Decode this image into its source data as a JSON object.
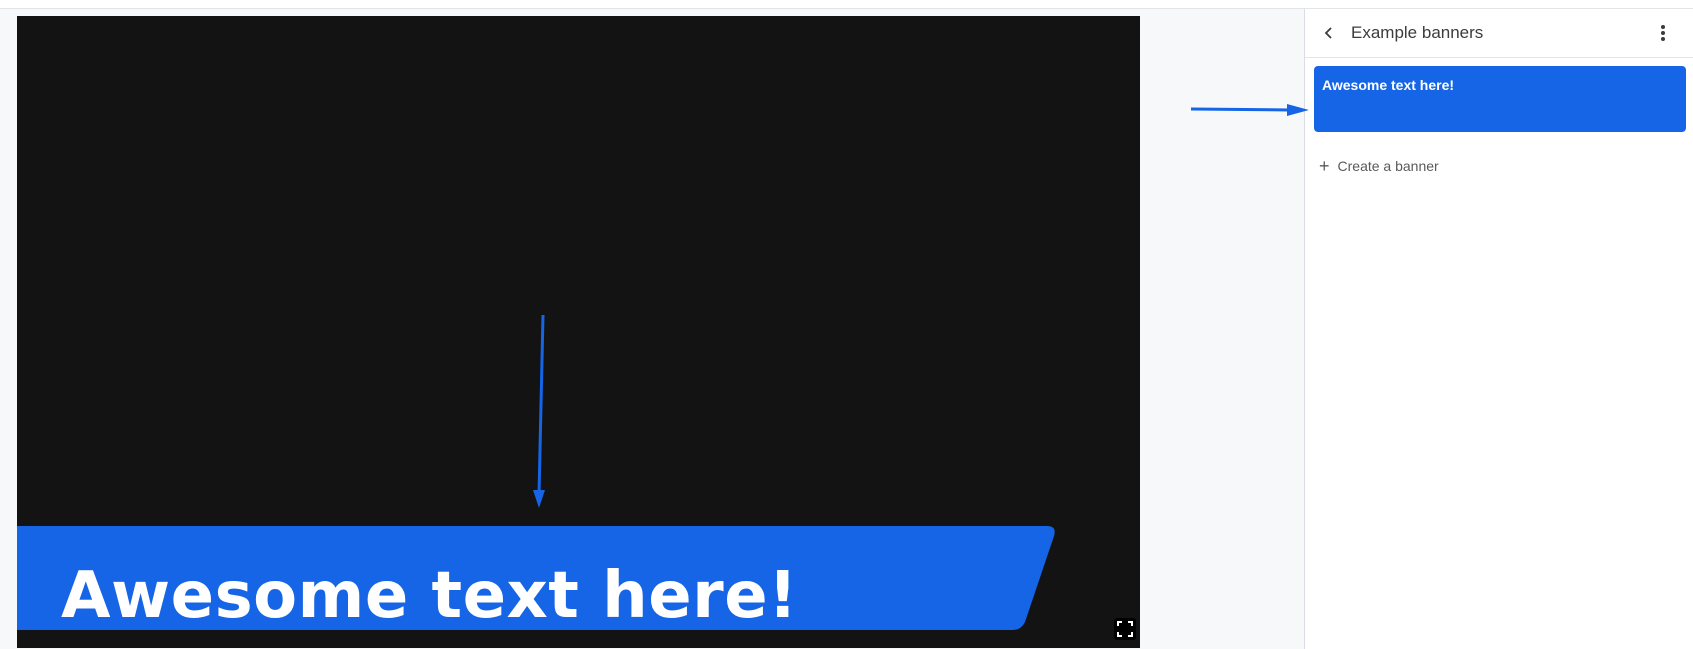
{
  "stage": {
    "banner_text": "Awesome text here!",
    "banner_color": "#1565e6",
    "background_color": "#131313",
    "fullscreen_icon": "fullscreen-icon"
  },
  "panel": {
    "title": "Example banners",
    "back_icon": "chevron-left-icon",
    "more_icon": "more-vertical-icon",
    "banners": [
      {
        "label": "Awesome text here!",
        "color": "#1565e6"
      }
    ],
    "create_label": "Create a banner",
    "create_icon": "plus-icon"
  },
  "annotations": {
    "arrow_color": "#1565e6"
  }
}
